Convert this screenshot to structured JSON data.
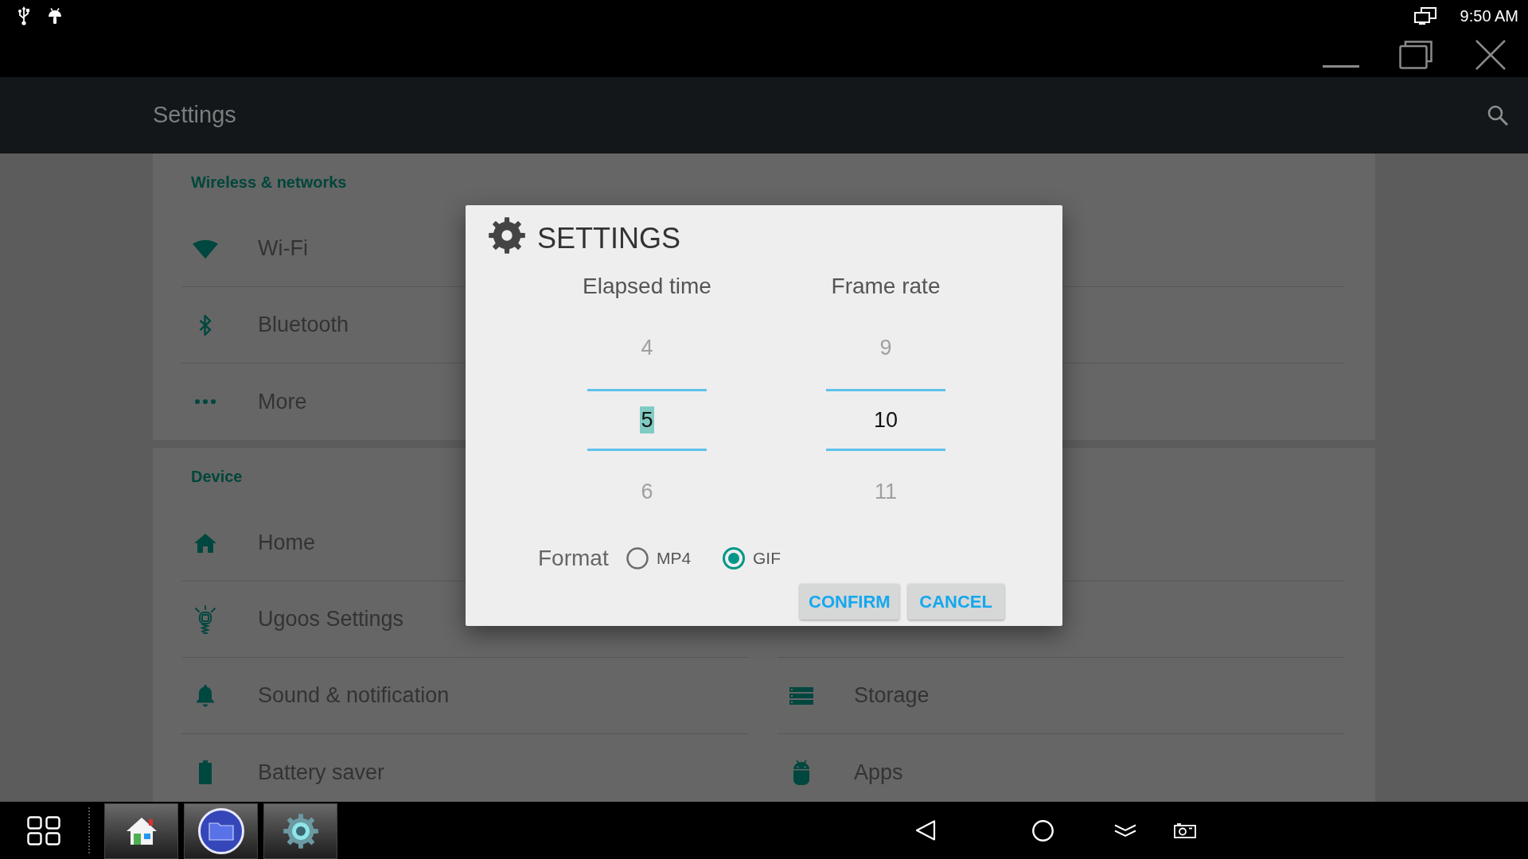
{
  "status_bar": {
    "time": "9:50 AM"
  },
  "app_bar": {
    "title": "Settings"
  },
  "sections": [
    {
      "header": "Wireless & networks",
      "rows": [
        {
          "left": {
            "label": "Wi-Fi"
          }
        },
        {
          "left": {
            "label": "Bluetooth"
          }
        },
        {
          "left": {
            "label": "More"
          }
        }
      ]
    },
    {
      "header": "Device",
      "rows": [
        {
          "left": {
            "label": "Home"
          }
        },
        {
          "left": {
            "label": "Ugoos Settings"
          }
        },
        {
          "left": {
            "label": "Sound & notification"
          },
          "right": {
            "label": "Storage"
          }
        },
        {
          "left": {
            "label": "Battery saver"
          },
          "right": {
            "label": "Apps"
          }
        }
      ]
    }
  ],
  "dialog": {
    "title": "SETTINGS",
    "pickers": [
      {
        "label": "Elapsed time",
        "above": "4",
        "value": "5",
        "below": "6",
        "text_selected": true
      },
      {
        "label": "Frame rate",
        "above": "9",
        "value": "10",
        "below": "11",
        "text_selected": false
      }
    ],
    "format": {
      "label": "Format",
      "options": [
        {
          "label": "MP4",
          "selected": false
        },
        {
          "label": "GIF",
          "selected": true
        }
      ]
    },
    "buttons": [
      {
        "label": "CONFIRM"
      },
      {
        "label": "CANCEL"
      }
    ]
  }
}
